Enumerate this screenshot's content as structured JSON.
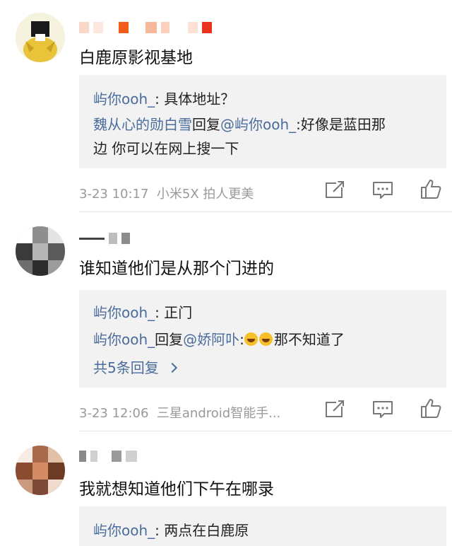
{
  "comments": [
    {
      "text": "白鹿原影视基地",
      "replies": [
        {
          "user": "屿你ooh_",
          "sep": ":",
          "text": "具体地址？"
        },
        {
          "user": "魏从心的勋白雪",
          "mid": "回复",
          "mention": "@屿你ooh_",
          "sep": ":",
          "text": "好像是蓝田那",
          "text2": "边 你可以在网上搜一下"
        }
      ],
      "time": "3-23 10:17",
      "source": "小米5X 拍人更美"
    },
    {
      "text": "谁知道他们是从那个门进的",
      "replies": [
        {
          "user": "屿你ooh_",
          "sep": ":",
          "text": "正门"
        },
        {
          "user": "屿你ooh_",
          "mid": "回复",
          "mention": "@娇阿卟",
          "sep": ":",
          "text": "那不知道了"
        }
      ],
      "more_replies": "共5条回复",
      "time": "3-23 12:06",
      "source": "三星android智能手..."
    },
    {
      "text": "我就想知道他们下午在哪录",
      "replies": [
        {
          "user": "屿你ooh_",
          "sep": ":",
          "text": "两点在白鹿原"
        }
      ]
    }
  ],
  "icons": {
    "share": "share-icon",
    "comment": "comment-icon",
    "like": "thumbs-up-icon"
  },
  "colors": {
    "username": "#4a6c9c",
    "meta": "#9a9a9a",
    "reply_bg": "#f2f2f2"
  }
}
